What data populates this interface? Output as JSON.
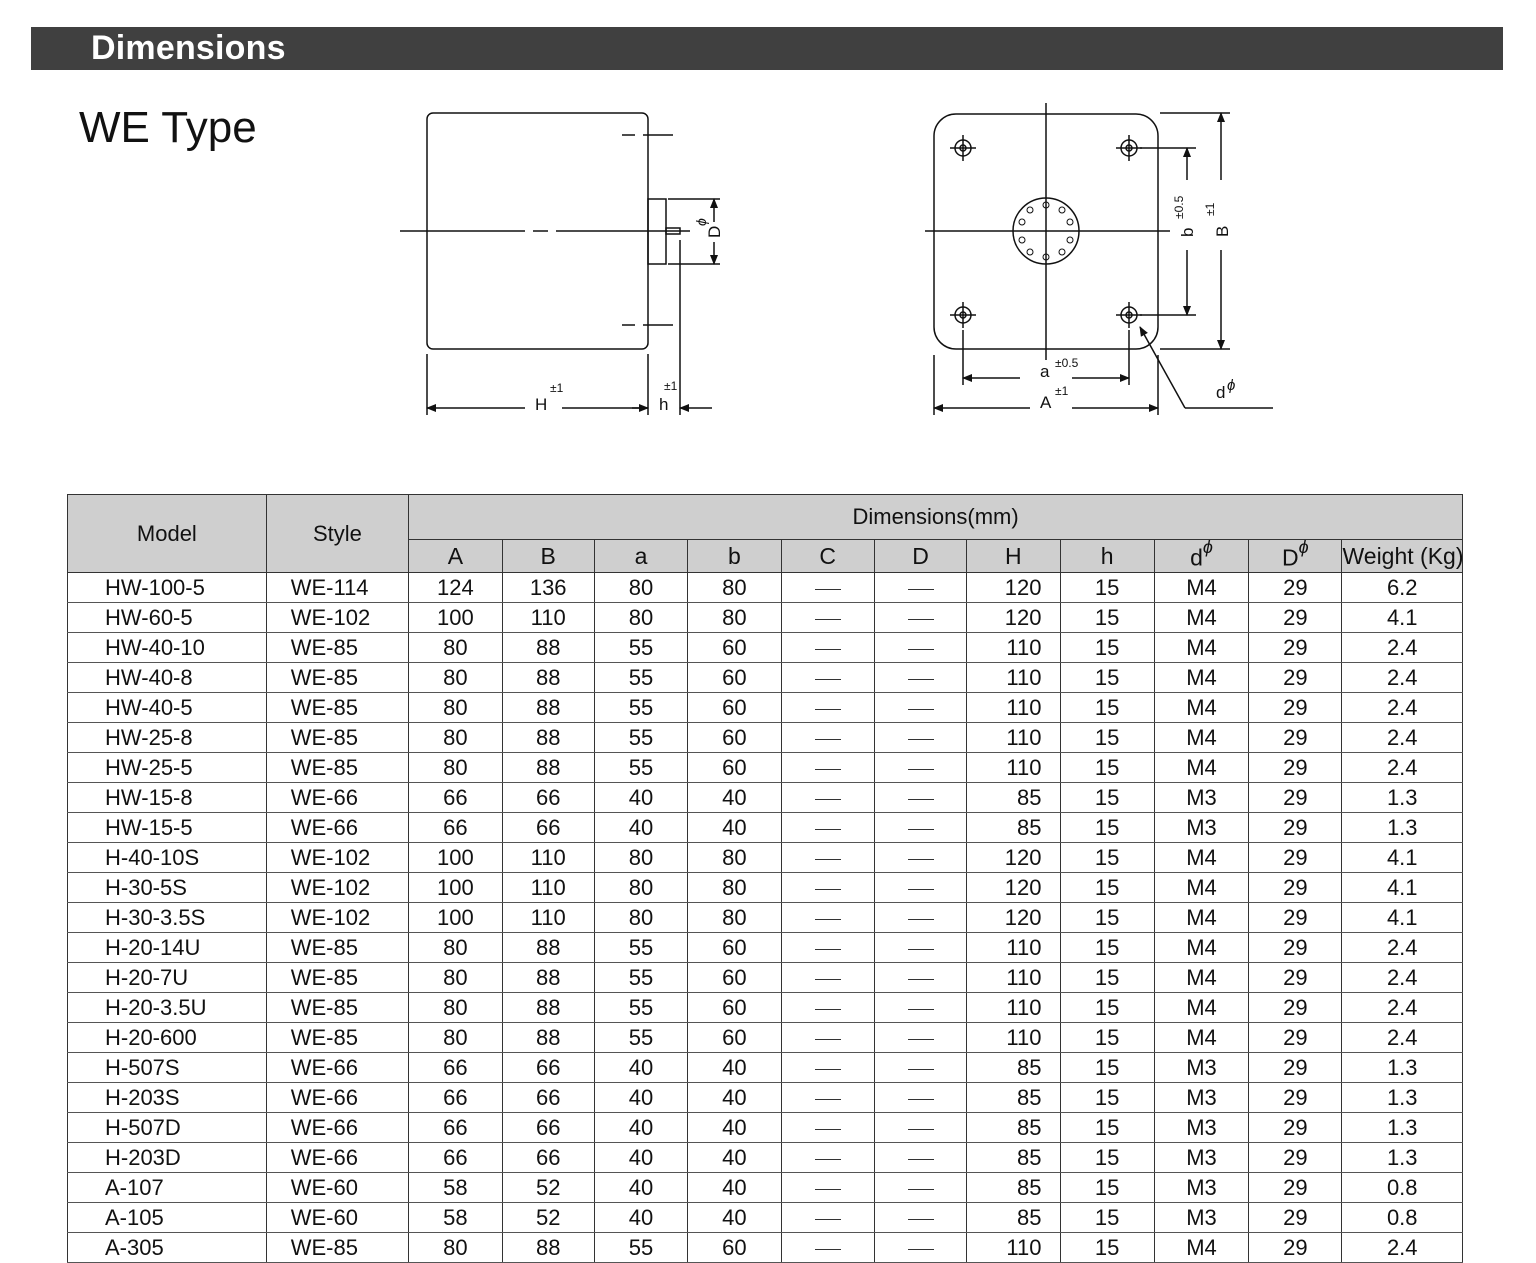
{
  "section_title": "Dimensions",
  "type_title": "WE Type",
  "drawing_labels": {
    "H": "H",
    "H_tol": "±1",
    "h": "h",
    "h_tol": "±1",
    "D": "D",
    "D_phi": "ϕ",
    "a": "a",
    "a_tol": "±0.5",
    "A": "A",
    "A_tol": "±1",
    "b": "b",
    "b_tol": "±0.5",
    "B": "B",
    "B_tol": "±1",
    "d": "d",
    "d_phi": "ϕ"
  },
  "table": {
    "header_model": "Model",
    "header_style": "Style",
    "header_group": "Dimensions(mm)",
    "columns": [
      "A",
      "B",
      "a",
      "b",
      "C",
      "D",
      "H",
      "h"
    ],
    "col_d": "d",
    "col_D": "D",
    "phi": "ϕ",
    "header_weight": "Weight (Kg)",
    "rows": [
      {
        "model": "HW-100-5",
        "style": "WE-114",
        "A": "124",
        "B": "136",
        "a": "80",
        "b": "80",
        "C": "—",
        "D": "—",
        "H": "120",
        "h": "15",
        "d": "M4",
        "Dphi": "29",
        "weight": "6.2"
      },
      {
        "model": "HW-60-5",
        "style": "WE-102",
        "A": "100",
        "B": "110",
        "a": "80",
        "b": "80",
        "C": "—",
        "D": "—",
        "H": "120",
        "h": "15",
        "d": "M4",
        "Dphi": "29",
        "weight": "4.1"
      },
      {
        "model": "HW-40-10",
        "style": "WE-85",
        "A": "80",
        "B": "88",
        "a": "55",
        "b": "60",
        "C": "—",
        "D": "—",
        "H": "110",
        "h": "15",
        "d": "M4",
        "Dphi": "29",
        "weight": "2.4"
      },
      {
        "model": "HW-40-8",
        "style": "WE-85",
        "A": "80",
        "B": "88",
        "a": "55",
        "b": "60",
        "C": "—",
        "D": "—",
        "H": "110",
        "h": "15",
        "d": "M4",
        "Dphi": "29",
        "weight": "2.4"
      },
      {
        "model": "HW-40-5",
        "style": "WE-85",
        "A": "80",
        "B": "88",
        "a": "55",
        "b": "60",
        "C": "—",
        "D": "—",
        "H": "110",
        "h": "15",
        "d": "M4",
        "Dphi": "29",
        "weight": "2.4"
      },
      {
        "model": "HW-25-8",
        "style": "WE-85",
        "A": "80",
        "B": "88",
        "a": "55",
        "b": "60",
        "C": "—",
        "D": "—",
        "H": "110",
        "h": "15",
        "d": "M4",
        "Dphi": "29",
        "weight": "2.4"
      },
      {
        "model": "HW-25-5",
        "style": "WE-85",
        "A": "80",
        "B": "88",
        "a": "55",
        "b": "60",
        "C": "—",
        "D": "—",
        "H": "110",
        "h": "15",
        "d": "M4",
        "Dphi": "29",
        "weight": "2.4"
      },
      {
        "model": "HW-15-8",
        "style": "WE-66",
        "A": "66",
        "B": "66",
        "a": "40",
        "b": "40",
        "C": "—",
        "D": "—",
        "H": "85",
        "h": "15",
        "d": "M3",
        "Dphi": "29",
        "weight": "1.3"
      },
      {
        "model": "HW-15-5",
        "style": "WE-66",
        "A": "66",
        "B": "66",
        "a": "40",
        "b": "40",
        "C": "—",
        "D": "—",
        "H": "85",
        "h": "15",
        "d": "M3",
        "Dphi": "29",
        "weight": "1.3"
      },
      {
        "model": "H-40-10S",
        "style": "WE-102",
        "A": "100",
        "B": "110",
        "a": "80",
        "b": "80",
        "C": "—",
        "D": "—",
        "H": "120",
        "h": "15",
        "d": "M4",
        "Dphi": "29",
        "weight": "4.1"
      },
      {
        "model": "H-30-5S",
        "style": "WE-102",
        "A": "100",
        "B": "110",
        "a": "80",
        "b": "80",
        "C": "—",
        "D": "—",
        "H": "120",
        "h": "15",
        "d": "M4",
        "Dphi": "29",
        "weight": "4.1"
      },
      {
        "model": "H-30-3.5S",
        "style": "WE-102",
        "A": "100",
        "B": "110",
        "a": "80",
        "b": "80",
        "C": "—",
        "D": "—",
        "H": "120",
        "h": "15",
        "d": "M4",
        "Dphi": "29",
        "weight": "4.1"
      },
      {
        "model": "H-20-14U",
        "style": "WE-85",
        "A": "80",
        "B": "88",
        "a": "55",
        "b": "60",
        "C": "—",
        "D": "—",
        "H": "110",
        "h": "15",
        "d": "M4",
        "Dphi": "29",
        "weight": "2.4"
      },
      {
        "model": "H-20-7U",
        "style": "WE-85",
        "A": "80",
        "B": "88",
        "a": "55",
        "b": "60",
        "C": "—",
        "D": "—",
        "H": "110",
        "h": "15",
        "d": "M4",
        "Dphi": "29",
        "weight": "2.4"
      },
      {
        "model": "H-20-3.5U",
        "style": "WE-85",
        "A": "80",
        "B": "88",
        "a": "55",
        "b": "60",
        "C": "—",
        "D": "—",
        "H": "110",
        "h": "15",
        "d": "M4",
        "Dphi": "29",
        "weight": "2.4"
      },
      {
        "model": "H-20-600",
        "style": "WE-85",
        "A": "80",
        "B": "88",
        "a": "55",
        "b": "60",
        "C": "—",
        "D": "—",
        "H": "110",
        "h": "15",
        "d": "M4",
        "Dphi": "29",
        "weight": "2.4"
      },
      {
        "model": "H-507S",
        "style": "WE-66",
        "A": "66",
        "B": "66",
        "a": "40",
        "b": "40",
        "C": "—",
        "D": "—",
        "H": "85",
        "h": "15",
        "d": "M3",
        "Dphi": "29",
        "weight": "1.3"
      },
      {
        "model": "H-203S",
        "style": "WE-66",
        "A": "66",
        "B": "66",
        "a": "40",
        "b": "40",
        "C": "—",
        "D": "—",
        "H": "85",
        "h": "15",
        "d": "M3",
        "Dphi": "29",
        "weight": "1.3"
      },
      {
        "model": "H-507D",
        "style": "WE-66",
        "A": "66",
        "B": "66",
        "a": "40",
        "b": "40",
        "C": "—",
        "D": "—",
        "H": "85",
        "h": "15",
        "d": "M3",
        "Dphi": "29",
        "weight": "1.3"
      },
      {
        "model": "H-203D",
        "style": "WE-66",
        "A": "66",
        "B": "66",
        "a": "40",
        "b": "40",
        "C": "—",
        "D": "—",
        "H": "85",
        "h": "15",
        "d": "M3",
        "Dphi": "29",
        "weight": "1.3"
      },
      {
        "model": "A-107",
        "style": "WE-60",
        "A": "58",
        "B": "52",
        "a": "40",
        "b": "40",
        "C": "—",
        "D": "—",
        "H": "85",
        "h": "15",
        "d": "M3",
        "Dphi": "29",
        "weight": "0.8"
      },
      {
        "model": "A-105",
        "style": "WE-60",
        "A": "58",
        "B": "52",
        "a": "40",
        "b": "40",
        "C": "—",
        "D": "—",
        "H": "85",
        "h": "15",
        "d": "M3",
        "Dphi": "29",
        "weight": "0.8"
      },
      {
        "model": "A-305",
        "style": "WE-85",
        "A": "80",
        "B": "88",
        "a": "55",
        "b": "60",
        "C": "—",
        "D": "—",
        "H": "110",
        "h": "15",
        "d": "M4",
        "Dphi": "29",
        "weight": "2.4"
      }
    ]
  }
}
